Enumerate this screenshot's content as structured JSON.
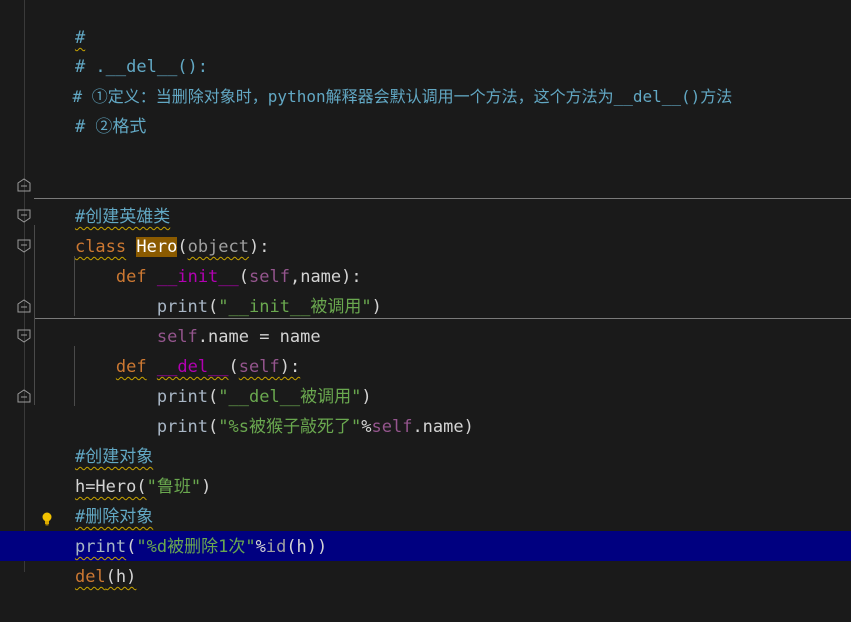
{
  "code": {
    "l1": "#",
    "l2": "# .__del__():",
    "l3": "# ①定义：当删除对象时，python解释器会默认调用一个方法，这个方法为__del__()方法",
    "l4": "# ②格式",
    "l7": "#创建英雄类",
    "l8_kw": "class",
    "l8_name": "Hero",
    "l8_open": "(",
    "l8_base": "object",
    "l8_close": "):",
    "l9_kw": "def",
    "l9_name": "__init__",
    "l9_open": "(",
    "l9_self": "self",
    "l9_rest": ",name):",
    "l10_fn": "print",
    "l10_open": "(",
    "l10_str": "\"__init__被调用\"",
    "l10_close": ")",
    "l11_self": "self",
    "l11_rest": ".name = name",
    "l12_kw": "def",
    "l12_name": "__del__",
    "l12_open": "(",
    "l12_self": "self",
    "l12_close": "):",
    "l13_fn": "print",
    "l13_open": "(",
    "l13_str": "\"__del__被调用\"",
    "l13_close": ")",
    "l14_fn": "print",
    "l14_open": "(",
    "l14_str": "\"%s被猴子敲死了\"",
    "l14_pct": "%",
    "l14_self": "self",
    "l14_rest": ".name)",
    "l15": "#创建对象",
    "l16_a": "h=Hero(",
    "l16_str": "\"鲁班\"",
    "l16_b": ")",
    "l17": "#删除对象",
    "l18_fn": "print",
    "l18_open": "(",
    "l18_str": "\"%d被删除1次\"",
    "l18_pct": "%",
    "l18_id": "id",
    "l18_rest": "(h))",
    "l19_kw": "del",
    "l19_rest": "(h)"
  },
  "icons": {
    "fold": "fold-marker-icon",
    "bulb": "lightbulb-icon"
  },
  "colors": {
    "background": "#1a1a1a",
    "current_line": "#000080",
    "comment": "#62a8c4",
    "keyword": "#cc7832",
    "string": "#6aa84f",
    "magic_method": "#b200b2",
    "self": "#94558d"
  }
}
